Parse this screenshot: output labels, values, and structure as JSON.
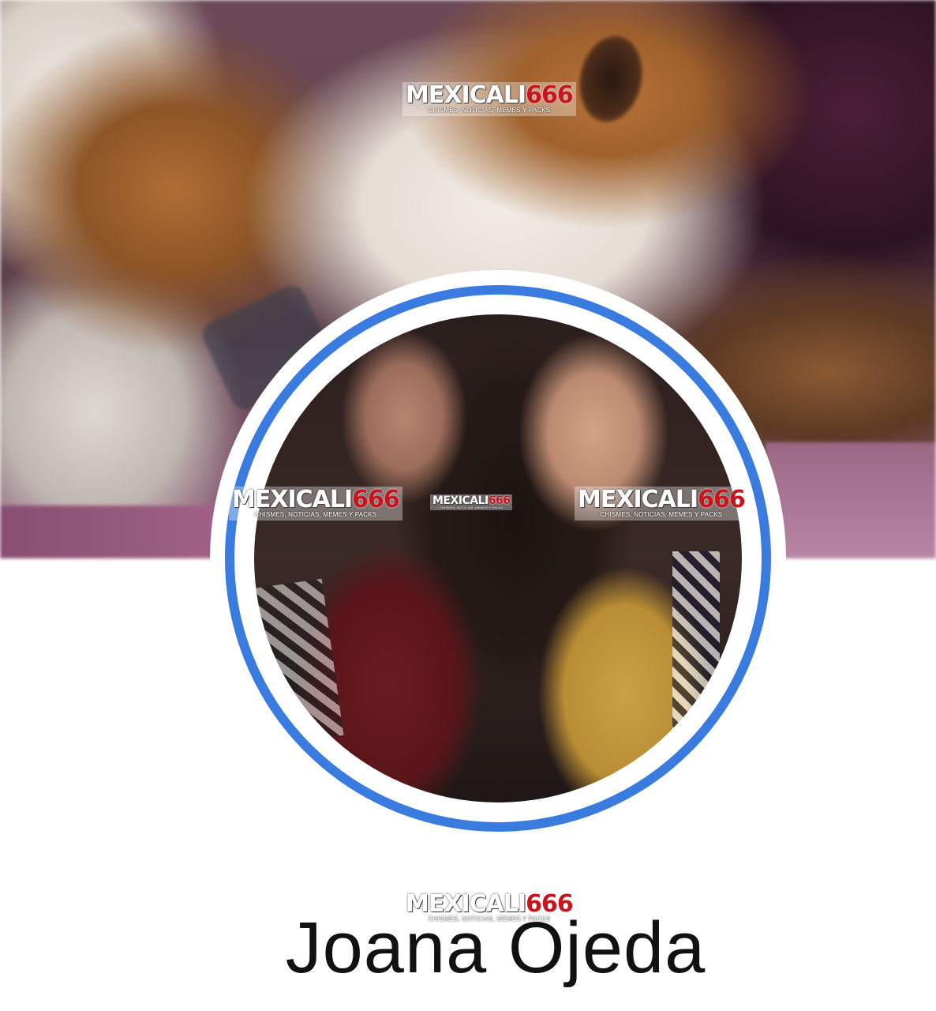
{
  "profile": {
    "name": "Joana Ojeda"
  },
  "watermarks": [
    {
      "main": "MEXICALI",
      "num": "666",
      "sub": "CHISMES, NOTICIAS, MEMES Y PACKS"
    },
    {
      "main": "MEXICALI",
      "num": "666",
      "sub": "CHISMES, NOTICIAS, MEMES Y PACKS"
    },
    {
      "main": "MEXICALI",
      "num": "666",
      "sub": "CHISMES, NOTICIAS, MEMES Y PACKS"
    },
    {
      "main": "MEXICALI",
      "num": "666",
      "sub": "CHISMES, NOTICIAS, MEMES Y PACKS"
    },
    {
      "main": "MEXICALI",
      "num": "666",
      "sub": "CHISMES, NOTICIAS, MEMES Y PACKS"
    }
  ],
  "colors": {
    "avatar_ring": "#3a7bdf",
    "watermark_accent": "#c8141c",
    "name_text": "#111111"
  }
}
